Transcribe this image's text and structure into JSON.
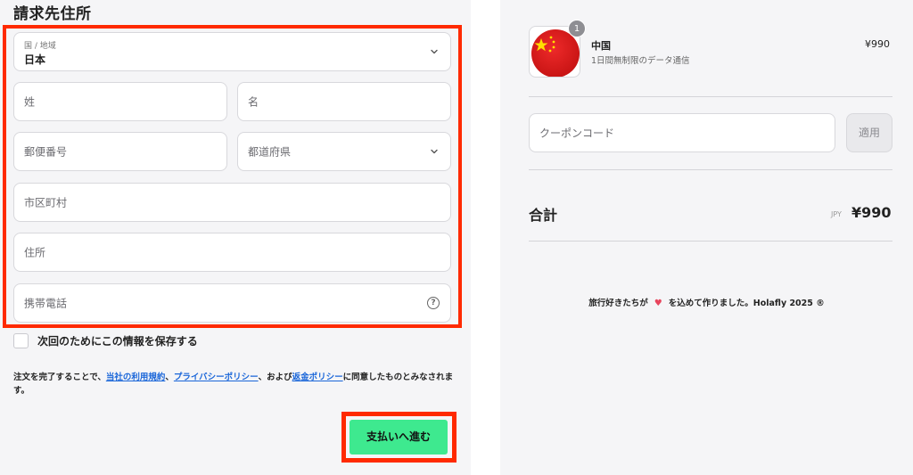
{
  "billing": {
    "title": "請求先住所",
    "country_label": "国 / 地域",
    "country_value": "日本",
    "last_name_placeholder": "姓",
    "first_name_placeholder": "名",
    "postal_placeholder": "郵便番号",
    "prefecture_placeholder": "都道府県",
    "city_placeholder": "市区町村",
    "address_placeholder": "住所",
    "phone_placeholder": "携帯電話",
    "save_info_label": "次回のためにこの情報を保存する",
    "terms": {
      "prefix": "注文を完了することで、",
      "link_terms": "当社の利用規約",
      "sep1": "、",
      "link_privacy": "プライバシーポリシー",
      "sep2": "、および",
      "link_refund": "返金ポリシー",
      "suffix": "に同意したものとみなされます。"
    },
    "pay_button": "支払いへ進む"
  },
  "order": {
    "item": {
      "quantity": "1",
      "name": "中国",
      "description": "1日間無制限のデータ通信",
      "price": "¥990"
    },
    "coupon_placeholder": "クーポンコード",
    "apply_label": "適用",
    "total_label": "合計",
    "total_currency": "JPY",
    "total_amount": "¥990"
  },
  "footer": {
    "before": "旅行好きたちが",
    "after": "を込めて作りました。Holafly 2025 ®"
  },
  "colors": {
    "accent_pay": "#3ee98f",
    "highlight": "#ff2a00",
    "link": "#1a66d9",
    "heart": "#e8455d"
  }
}
